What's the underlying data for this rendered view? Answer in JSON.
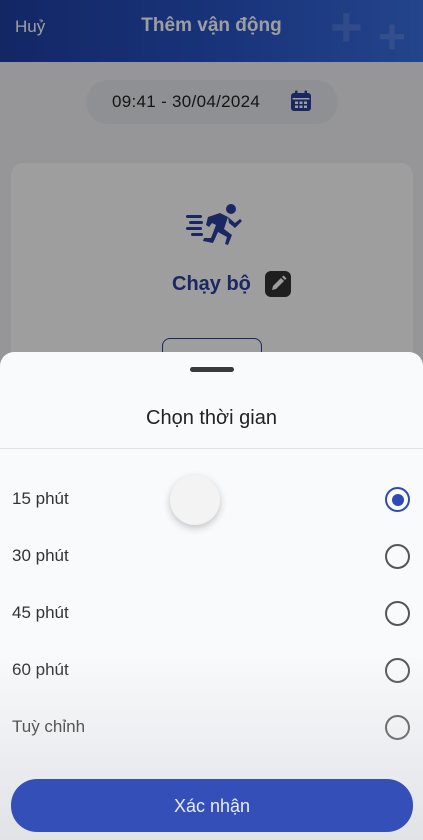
{
  "header": {
    "cancel_label": "Huỷ",
    "title": "Thêm vận động"
  },
  "date_picker": {
    "value": "09:41 - 30/04/2024",
    "icon": "calendar-icon"
  },
  "activity": {
    "icon": "running-icon",
    "name": "Chạy bộ",
    "edit_icon": "pencil-icon"
  },
  "sheet": {
    "title": "Chọn thời gian",
    "options": [
      {
        "label": "15 phút",
        "selected": true
      },
      {
        "label": "30 phút",
        "selected": false
      },
      {
        "label": "45 phút",
        "selected": false
      },
      {
        "label": "60 phút",
        "selected": false
      },
      {
        "label": "Tuỳ chỉnh",
        "selected": false
      }
    ],
    "confirm_label": "Xác nhận"
  },
  "colors": {
    "primary": "#3149b8",
    "header_start": "#1f3fa3",
    "header_end": "#3a6fe0"
  }
}
